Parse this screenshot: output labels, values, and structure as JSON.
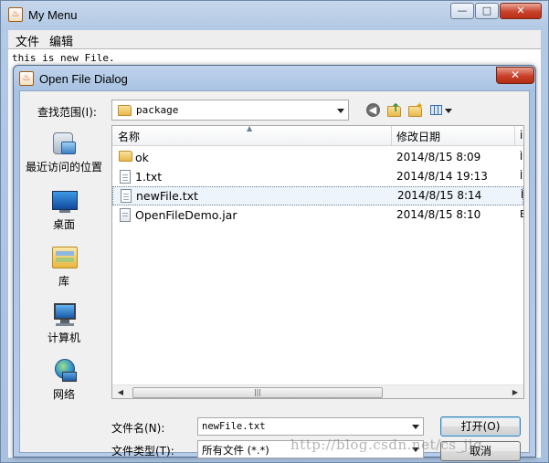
{
  "main_window": {
    "title": "My Menu",
    "controls": {
      "minimize": "—",
      "maximize": "□",
      "close": "✕"
    },
    "menu": [
      "文件",
      "编辑"
    ],
    "text_content": "this is new File."
  },
  "dialog": {
    "title": "Open File Dialog",
    "close": "✕",
    "look_in_label": "查找范围(I):",
    "look_in_value": "package",
    "places": [
      {
        "label": "最近访问的位置",
        "icon": "recent-places-icon"
      },
      {
        "label": "桌面",
        "icon": "desktop-icon"
      },
      {
        "label": "库",
        "icon": "libraries-icon"
      },
      {
        "label": "计算机",
        "icon": "computer-icon"
      },
      {
        "label": "网络",
        "icon": "network-icon"
      }
    ],
    "columns": {
      "name": "名称",
      "modified": "修改日期",
      "extra": "i"
    },
    "files": [
      {
        "name": "ok",
        "date": "2014/8/15 8:09",
        "extra": "Ì",
        "icon": "folder-icon"
      },
      {
        "name": "1.txt",
        "date": "2014/8/14 19:13",
        "extra": "Ì",
        "icon": "text-file-icon"
      },
      {
        "name": "newFile.txt",
        "date": "2014/8/15 8:14",
        "extra": "Ì",
        "icon": "text-file-icon",
        "selected": true
      },
      {
        "name": "OpenFileDemo.jar",
        "date": "2014/8/15 8:10",
        "extra": "E",
        "icon": "jar-file-icon"
      }
    ],
    "file_name_label": "文件名(N):",
    "file_name_value": "newFile.txt",
    "file_type_label": "文件类型(T):",
    "file_type_value": "所有文件 (*.*)",
    "open_button": "打开(O)",
    "cancel_button": "取消"
  },
  "watermark": "http://blog.csdn.net/cs_jig"
}
